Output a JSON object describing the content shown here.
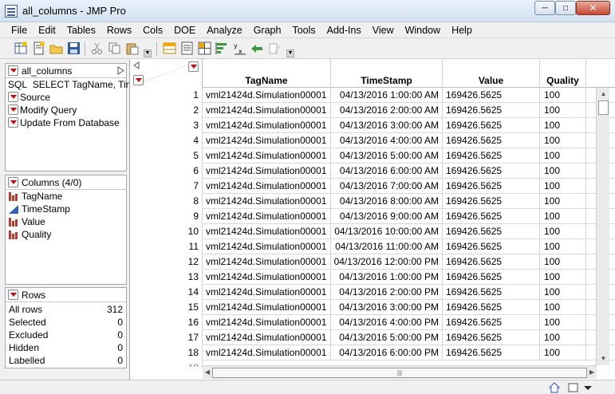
{
  "window": {
    "title": "all_columns - JMP Pro"
  },
  "menu": [
    "File",
    "Edit",
    "Tables",
    "Rows",
    "Cols",
    "DOE",
    "Analyze",
    "Graph",
    "Tools",
    "Add-Ins",
    "View",
    "Window",
    "Help"
  ],
  "table_panel": {
    "name": "all_columns",
    "sql_label": "SQL",
    "sql_text": "SELECT TagName, Tim",
    "scripts": [
      "Source",
      "Modify Query",
      "Update From Database"
    ]
  },
  "columns_panel": {
    "title": "Columns (4/0)",
    "items": [
      {
        "name": "TagName",
        "icon": "nominal-icon"
      },
      {
        "name": "TimeStamp",
        "icon": "continuous-icon"
      },
      {
        "name": "Value",
        "icon": "nominal-icon"
      },
      {
        "name": "Quality",
        "icon": "nominal-icon"
      }
    ]
  },
  "rows_panel": {
    "title": "Rows",
    "items": [
      {
        "label": "All rows",
        "value": "312"
      },
      {
        "label": "Selected",
        "value": "0"
      },
      {
        "label": "Excluded",
        "value": "0"
      },
      {
        "label": "Hidden",
        "value": "0"
      },
      {
        "label": "Labelled",
        "value": "0"
      }
    ]
  },
  "grid": {
    "headers": [
      "TagName",
      "TimeStamp",
      "Value",
      "Quality"
    ],
    "rows": [
      [
        "1",
        "vml21424d.Simulation00001",
        "04/13/2016 1:00:00 AM",
        "169426.5625",
        "100"
      ],
      [
        "2",
        "vml21424d.Simulation00001",
        "04/13/2016 2:00:00 AM",
        "169426.5625",
        "100"
      ],
      [
        "3",
        "vml21424d.Simulation00001",
        "04/13/2016 3:00:00 AM",
        "169426.5625",
        "100"
      ],
      [
        "4",
        "vml21424d.Simulation00001",
        "04/13/2016 4:00:00 AM",
        "169426.5625",
        "100"
      ],
      [
        "5",
        "vml21424d.Simulation00001",
        "04/13/2016 5:00:00 AM",
        "169426.5625",
        "100"
      ],
      [
        "6",
        "vml21424d.Simulation00001",
        "04/13/2016 6:00:00 AM",
        "169426.5625",
        "100"
      ],
      [
        "7",
        "vml21424d.Simulation00001",
        "04/13/2016 7:00:00 AM",
        "169426.5625",
        "100"
      ],
      [
        "8",
        "vml21424d.Simulation00001",
        "04/13/2016 8:00:00 AM",
        "169426.5625",
        "100"
      ],
      [
        "9",
        "vml21424d.Simulation00001",
        "04/13/2016 9:00:00 AM",
        "169426.5625",
        "100"
      ],
      [
        "10",
        "vml21424d.Simulation00001",
        "04/13/2016 10:00:00 AM",
        "169426.5625",
        "100"
      ],
      [
        "11",
        "vml21424d.Simulation00001",
        "04/13/2016 11:00:00 AM",
        "169426.5625",
        "100"
      ],
      [
        "12",
        "vml21424d.Simulation00001",
        "04/13/2016 12:00:00 PM",
        "169426.5625",
        "100"
      ],
      [
        "13",
        "vml21424d.Simulation00001",
        "04/13/2016 1:00:00 PM",
        "169426.5625",
        "100"
      ],
      [
        "14",
        "vml21424d.Simulation00001",
        "04/13/2016 2:00:00 PM",
        "169426.5625",
        "100"
      ],
      [
        "15",
        "vml21424d.Simulation00001",
        "04/13/2016 3:00:00 PM",
        "169426.5625",
        "100"
      ],
      [
        "16",
        "vml21424d.Simulation00001",
        "04/13/2016 4:00:00 PM",
        "169426.5625",
        "100"
      ],
      [
        "17",
        "vml21424d.Simulation00001",
        "04/13/2016 5:00:00 PM",
        "169426.5625",
        "100"
      ],
      [
        "18",
        "vml21424d.Simulation00001",
        "04/13/2016 6:00:00 PM",
        "169426.5625",
        "100"
      ]
    ]
  },
  "colors": {
    "red_triangle": "#dd0000",
    "nominal": "#c0392b",
    "continuous": "#2d62b6"
  }
}
